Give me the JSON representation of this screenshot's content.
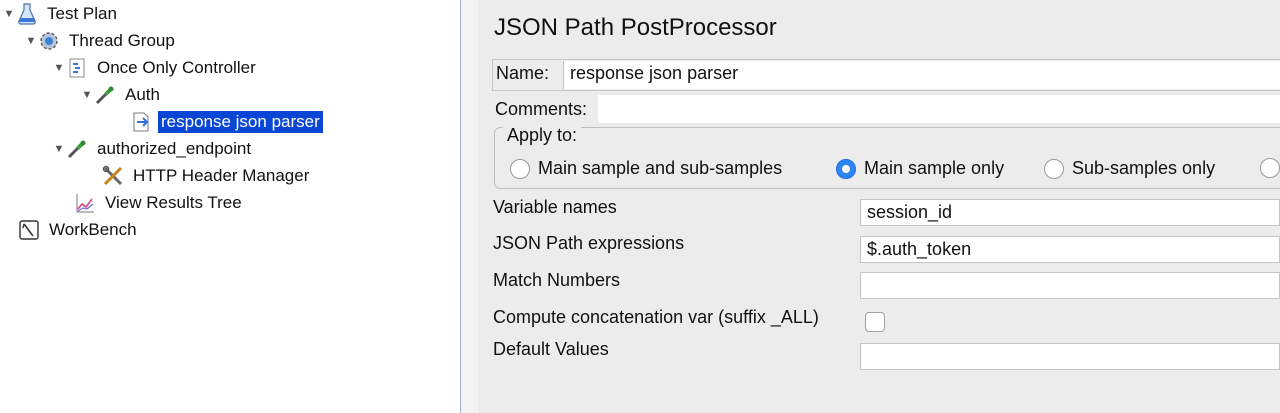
{
  "tree": {
    "items": [
      {
        "label": "Test Plan",
        "toggle": "▼",
        "icon": "flask-icon"
      },
      {
        "label": "Thread Group",
        "toggle": "▼",
        "icon": "gear-icon"
      },
      {
        "label": "Once Only Controller",
        "toggle": "▼",
        "icon": "controller-icon"
      },
      {
        "label": "Auth",
        "toggle": "▼",
        "icon": "pipette-icon"
      },
      {
        "label": "response json parser",
        "toggle": "",
        "icon": "postprocessor-icon",
        "selected": true
      },
      {
        "label": "authorized_endpoint",
        "toggle": "▼",
        "icon": "pipette-icon"
      },
      {
        "label": "HTTP Header Manager",
        "toggle": "",
        "icon": "tools-icon"
      },
      {
        "label": "View Results Tree",
        "toggle": "",
        "icon": "chart-icon"
      },
      {
        "label": "WorkBench",
        "toggle": "",
        "icon": "workbench-icon"
      }
    ]
  },
  "panel": {
    "title": "JSON Path PostProcessor",
    "name_label": "Name:",
    "name_value": "response json parser",
    "comments_label": "Comments:",
    "comments_value": "",
    "apply_to": {
      "legend": "Apply to:",
      "options": [
        {
          "label": "Main sample and sub-samples",
          "selected": false
        },
        {
          "label": "Main sample only",
          "selected": true
        },
        {
          "label": "Sub-samples only",
          "selected": false
        }
      ]
    },
    "fields": {
      "variable_names_label": "Variable names",
      "variable_names_value": "session_id",
      "json_path_label": "JSON Path expressions",
      "json_path_value": "$.auth_token",
      "match_numbers_label": "Match Numbers",
      "match_numbers_value": "",
      "concat_label": "Compute concatenation var (suffix _ALL)",
      "concat_checked": false,
      "default_values_label": "Default Values",
      "default_values_value": ""
    }
  },
  "colors": {
    "selection": "#0a46d6",
    "panel_bg": "#ececec",
    "radio_selected": "#2f86f3"
  }
}
